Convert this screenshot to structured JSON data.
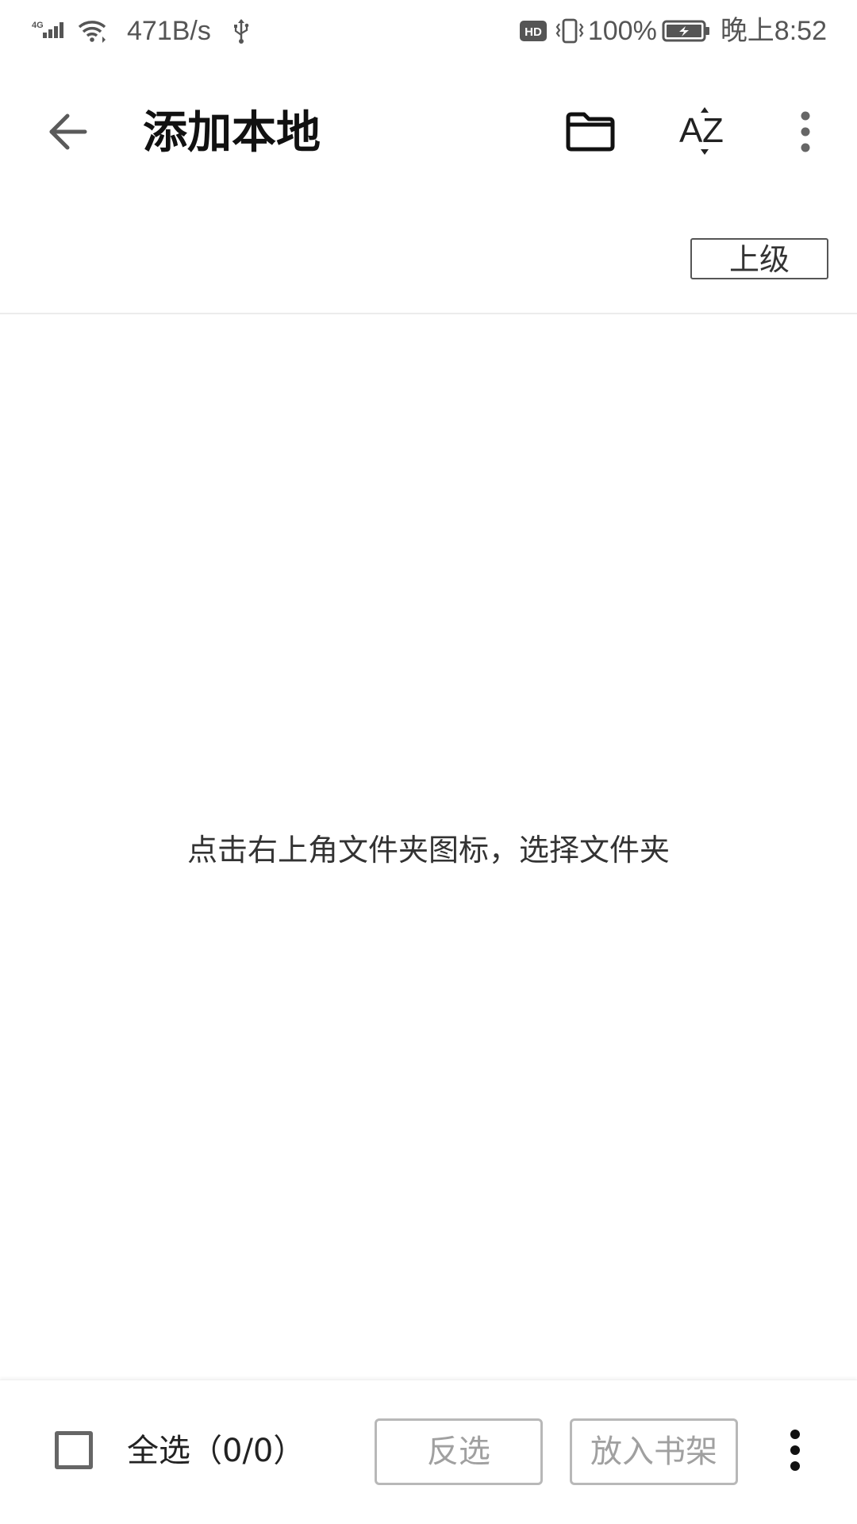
{
  "status_bar": {
    "network_type": "4G",
    "net_speed": "471B/s",
    "hd_badge": "HD",
    "battery_percent": "100%",
    "time": "晚上8:52",
    "icons": [
      "signal-4g-icon",
      "wifi-icon",
      "usb-icon",
      "hd-icon",
      "vibrate-icon",
      "battery-charging-icon"
    ]
  },
  "app_bar": {
    "title": "添加本地",
    "icons": [
      "back-arrow-icon",
      "folder-icon",
      "sort-az-icon",
      "more-vertical-icon"
    ]
  },
  "path_row": {
    "parent_label": "上级"
  },
  "content": {
    "empty_hint": "点击右上角文件夹图标，选择文件夹"
  },
  "bottom_bar": {
    "select_all_checked": false,
    "select_all_label": "全选（0/0）",
    "invert_label": "反选",
    "add_to_shelf_label": "放入书架",
    "icons": [
      "checkbox-icon",
      "more-vertical-icon"
    ]
  },
  "colors": {
    "background": "#ffffff",
    "text_primary": "#111111",
    "text_secondary": "#555555",
    "disabled_text": "#a0a0a0",
    "disabled_border": "#b8b8b8",
    "divider": "#ececec"
  }
}
